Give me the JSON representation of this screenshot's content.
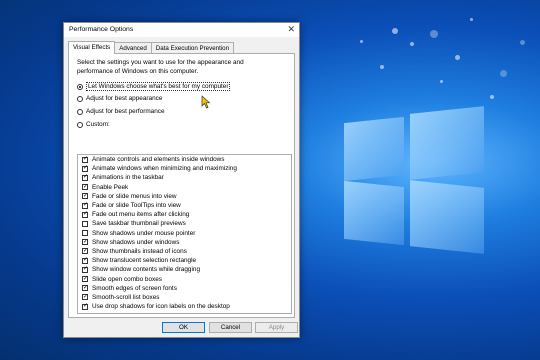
{
  "dialog": {
    "title": "Performance Options",
    "close_icon": "close-icon",
    "tabs": [
      "Visual Effects",
      "Advanced",
      "Data Execution Prevention"
    ],
    "active_tab": "Visual Effects",
    "description": "Select the settings you want to use for the appearance and performance of Windows on this computer.",
    "radios": [
      {
        "label": "Let Windows choose what's best for my computer",
        "selected": true
      },
      {
        "label": "Adjust for best appearance",
        "selected": false
      },
      {
        "label": "Adjust for best performance",
        "selected": false
      },
      {
        "label": "Custom:",
        "selected": false
      }
    ],
    "effects": [
      {
        "label": "Animate controls and elements inside windows",
        "checked": true
      },
      {
        "label": "Animate windows when minimizing and maximizing",
        "checked": true
      },
      {
        "label": "Animations in the taskbar",
        "checked": true
      },
      {
        "label": "Enable Peek",
        "checked": true
      },
      {
        "label": "Fade or slide menus into view",
        "checked": true
      },
      {
        "label": "Fade or slide ToolTips into view",
        "checked": true
      },
      {
        "label": "Fade out menu items after clicking",
        "checked": true
      },
      {
        "label": "Save taskbar thumbnail previews",
        "checked": false
      },
      {
        "label": "Show shadows under mouse pointer",
        "checked": false
      },
      {
        "label": "Show shadows under windows",
        "checked": true
      },
      {
        "label": "Show thumbnails instead of icons",
        "checked": true
      },
      {
        "label": "Show translucent selection rectangle",
        "checked": true
      },
      {
        "label": "Show window contents while dragging",
        "checked": true
      },
      {
        "label": "Slide open combo boxes",
        "checked": true
      },
      {
        "label": "Smooth edges of screen fonts",
        "checked": true
      },
      {
        "label": "Smooth-scroll list boxes",
        "checked": true
      },
      {
        "label": "Use drop shadows for icon labels on the desktop",
        "checked": true
      }
    ],
    "buttons": {
      "ok": "OK",
      "cancel": "Cancel",
      "apply": "Apply"
    }
  },
  "desktop": {
    "wallpaper_colors": [
      "#5fb6ff",
      "#1f7fe0",
      "#0b4fb8",
      "#04306f"
    ],
    "logo_icon": "windows-logo-icon"
  }
}
